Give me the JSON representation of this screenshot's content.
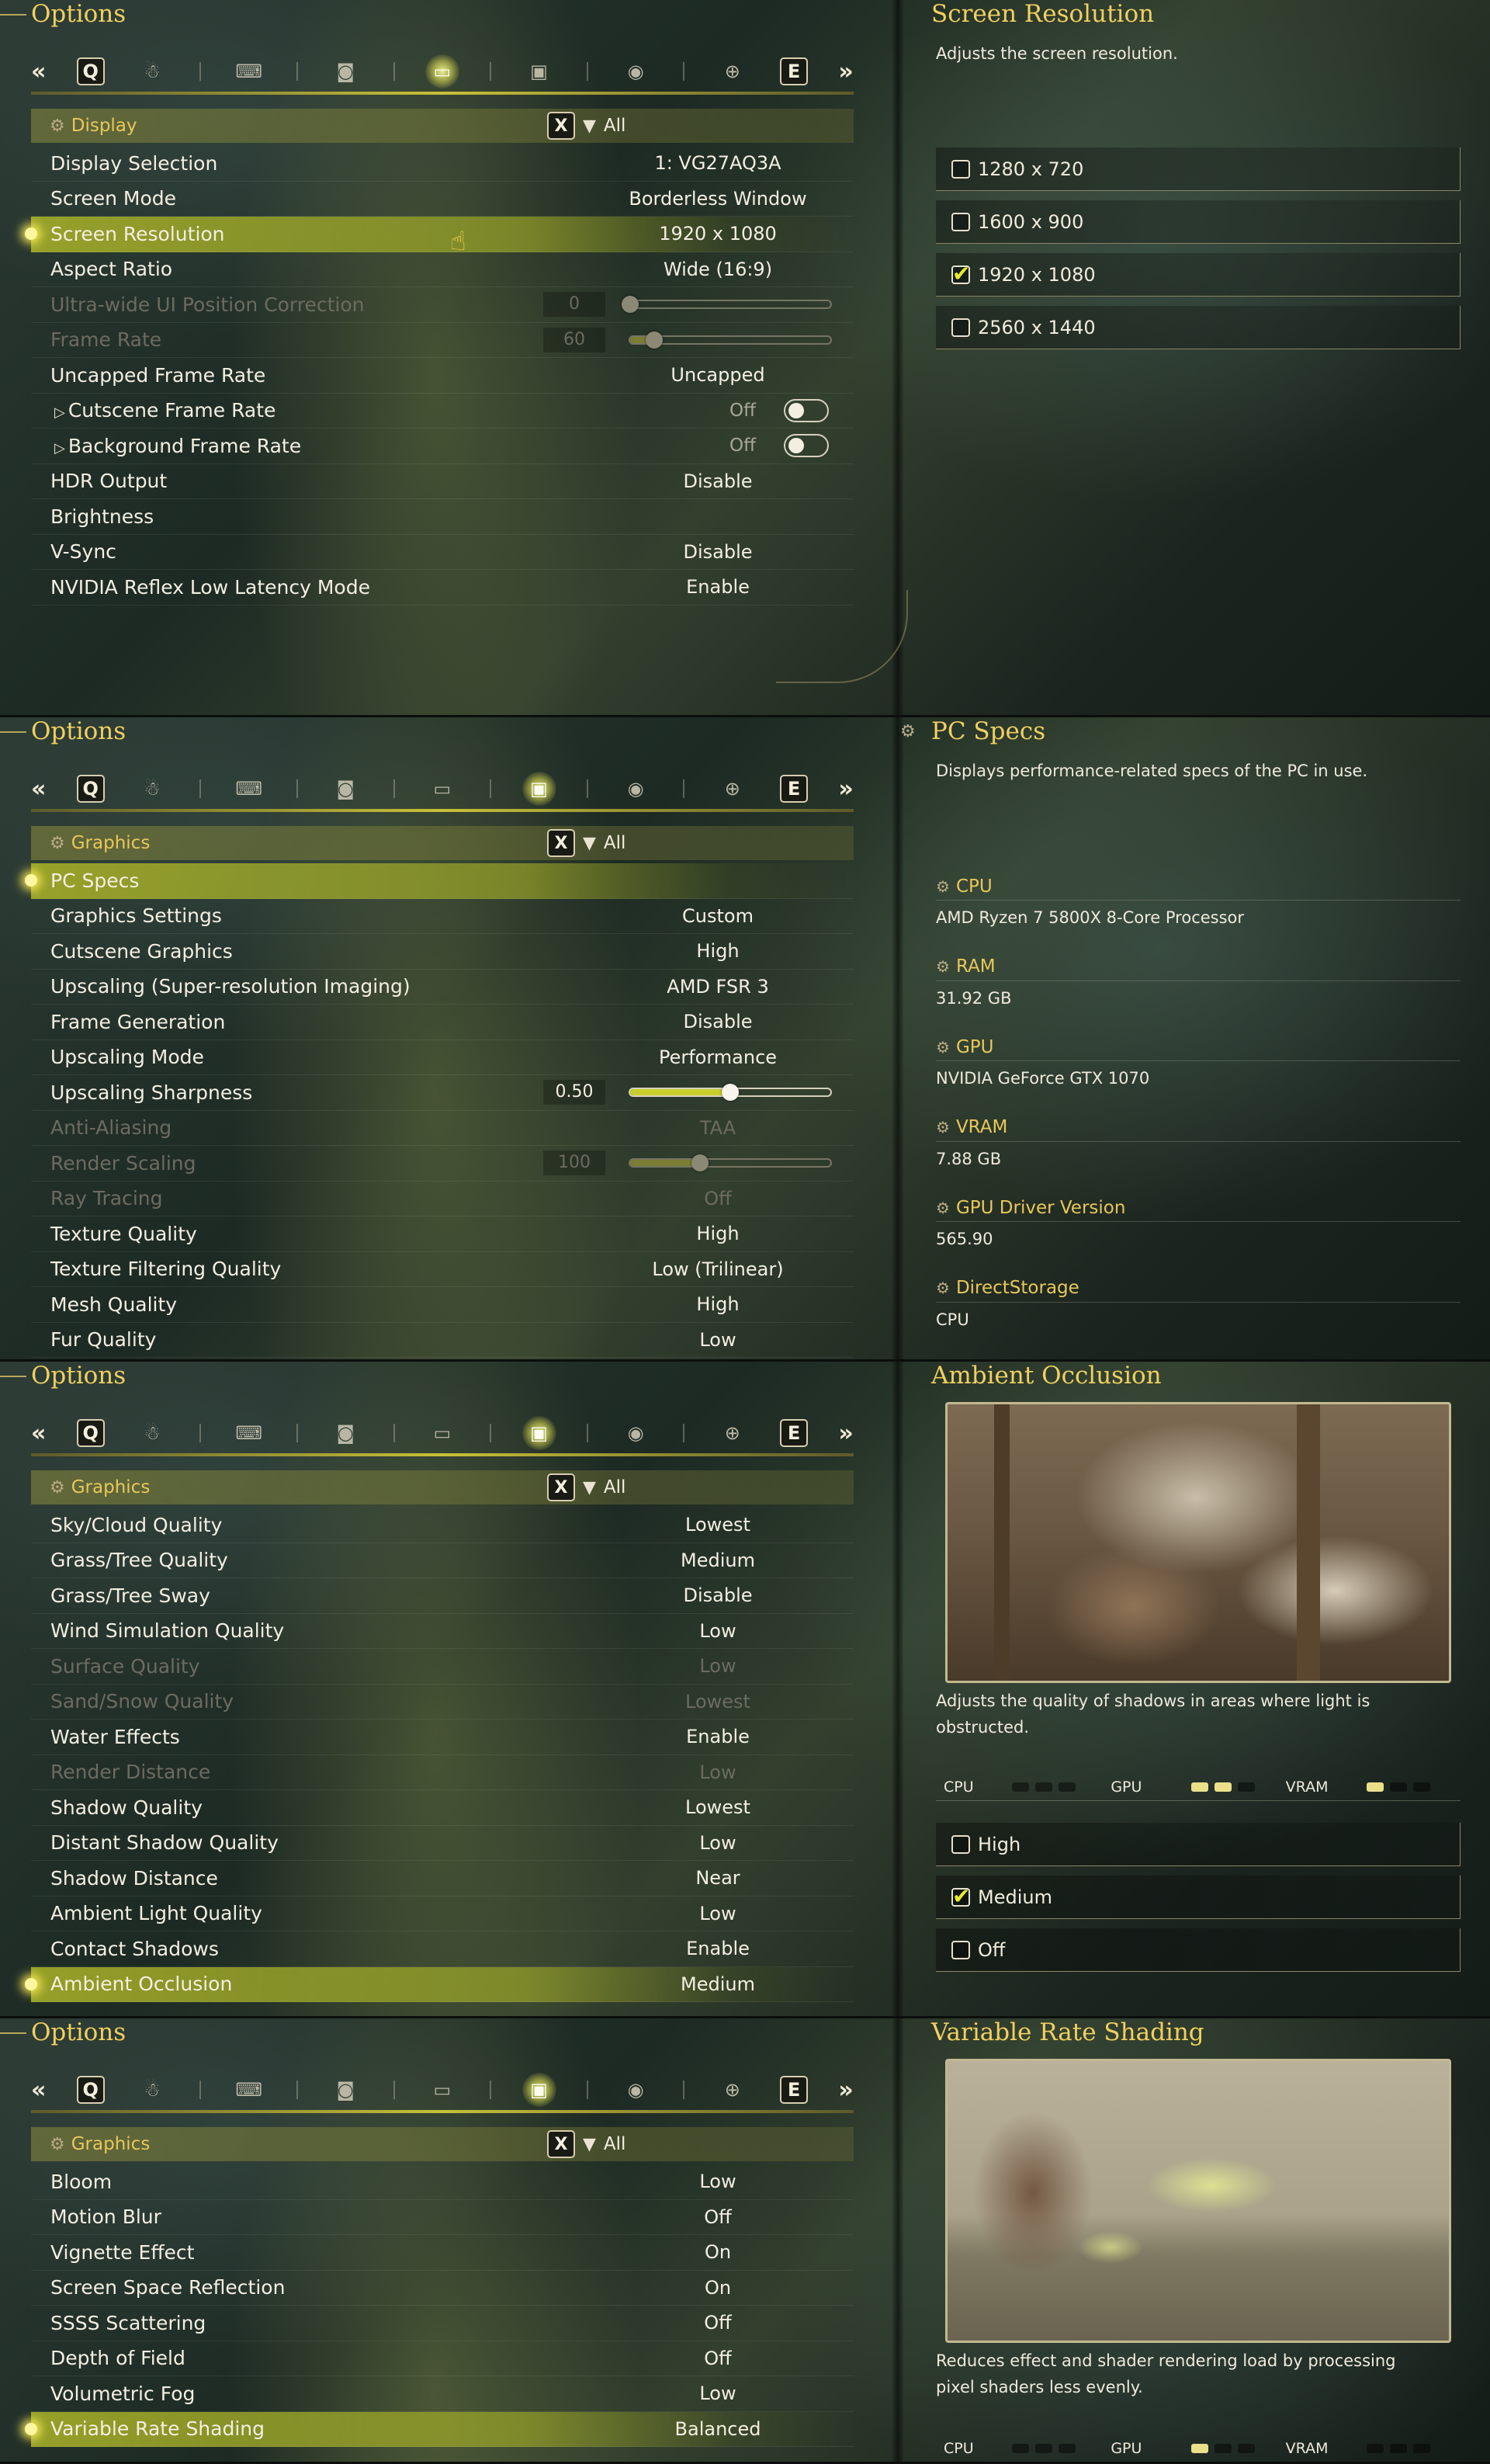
{
  "shared": {
    "options_title": "Options",
    "tab_left_key": "Q",
    "tab_right_key": "E",
    "left_arrows": "«",
    "right_arrows": "»",
    "filter_key": "X",
    "filter_label": "All",
    "tab_icons": [
      "character-icon",
      "controller-icon",
      "camera-icon",
      "display-icon",
      "graphics-icon",
      "audio-icon",
      "accessibility-icon"
    ],
    "accent_color": "#c8cf2a",
    "title_color": "#f0d060"
  },
  "panel1": {
    "category": "Display",
    "rows": [
      {
        "label": "Display Selection",
        "value": "1: VG27AQ3A"
      },
      {
        "label": "Screen Mode",
        "value": "Borderless Window"
      },
      {
        "label": "Screen Resolution",
        "value": "1920 x 1080"
      },
      {
        "label": "Aspect Ratio",
        "value": "Wide (16:9)"
      },
      {
        "label": "Ultra-wide UI Position Correction",
        "value": "0",
        "slider": 0
      },
      {
        "label": "Frame Rate",
        "value": "60",
        "slider": 0.12
      },
      {
        "label": "Uncapped Frame Rate",
        "value": "Uncapped"
      },
      {
        "label": "Cutscene Frame Rate",
        "value": "Off"
      },
      {
        "label": "Background Frame Rate",
        "value": "Off"
      },
      {
        "label": "HDR Output",
        "value": "Disable"
      },
      {
        "label": "Brightness",
        "value": ""
      },
      {
        "label": "V-Sync",
        "value": "Disable"
      },
      {
        "label": "NVIDIA Reflex Low Latency Mode",
        "value": "Enable"
      }
    ],
    "right_title": "Screen Resolution",
    "right_desc": "Adjusts the screen resolution.",
    "choices": [
      {
        "label": "1280 x 720",
        "checked": false
      },
      {
        "label": "1600 x 900",
        "checked": false
      },
      {
        "label": "1920 x 1080",
        "checked": true
      },
      {
        "label": "2560 x 1440",
        "checked": false
      }
    ]
  },
  "panel2": {
    "category": "Graphics",
    "rows": [
      {
        "label": "PC Specs",
        "value": ""
      },
      {
        "label": "Graphics Settings",
        "value": "Custom"
      },
      {
        "label": "Cutscene Graphics",
        "value": "High"
      },
      {
        "label": "Upscaling (Super-resolution Imaging)",
        "value": "AMD FSR 3"
      },
      {
        "label": "Frame Generation",
        "value": "Disable"
      },
      {
        "label": "Upscaling Mode",
        "value": "Performance"
      },
      {
        "label": "Upscaling Sharpness",
        "value": "0.50",
        "slider": 0.5
      },
      {
        "label": "Anti-Aliasing",
        "value": "TAA"
      },
      {
        "label": "Render Scaling",
        "value": "100",
        "slider": 0.35
      },
      {
        "label": "Ray Tracing",
        "value": "Off"
      },
      {
        "label": "Texture Quality",
        "value": "High"
      },
      {
        "label": "Texture Filtering Quality",
        "value": "Low (Trilinear)"
      },
      {
        "label": "Mesh Quality",
        "value": "High"
      },
      {
        "label": "Fur Quality",
        "value": "Low"
      }
    ],
    "right_title": "PC Specs",
    "right_desc": "Displays performance-related specs of the PC in use.",
    "specs": [
      {
        "name": "CPU",
        "value": "AMD Ryzen 7 5800X 8-Core Processor"
      },
      {
        "name": "RAM",
        "value": "31.92 GB"
      },
      {
        "name": "GPU",
        "value": "NVIDIA GeForce GTX 1070"
      },
      {
        "name": "VRAM",
        "value": "7.88 GB"
      },
      {
        "name": "GPU Driver Version",
        "value": "565.90"
      },
      {
        "name": "DirectStorage",
        "value": "CPU"
      }
    ]
  },
  "panel3": {
    "category": "Graphics",
    "rows": [
      {
        "label": "Sky/Cloud Quality",
        "value": "Lowest"
      },
      {
        "label": "Grass/Tree Quality",
        "value": "Medium"
      },
      {
        "label": "Grass/Tree Sway",
        "value": "Disable"
      },
      {
        "label": "Wind Simulation Quality",
        "value": "Low"
      },
      {
        "label": "Surface Quality",
        "value": "Low"
      },
      {
        "label": "Sand/Snow Quality",
        "value": "Lowest"
      },
      {
        "label": "Water Effects",
        "value": "Enable"
      },
      {
        "label": "Render Distance",
        "value": "Low"
      },
      {
        "label": "Shadow Quality",
        "value": "Lowest"
      },
      {
        "label": "Distant Shadow Quality",
        "value": "Low"
      },
      {
        "label": "Shadow Distance",
        "value": "Near"
      },
      {
        "label": "Ambient Light Quality",
        "value": "Low"
      },
      {
        "label": "Contact Shadows",
        "value": "Enable"
      },
      {
        "label": "Ambient Occlusion",
        "value": "Medium"
      }
    ],
    "right_title": "Ambient Occlusion",
    "right_desc": "Adjusts the quality of shadows in areas where light is obstructed.",
    "load": {
      "cpu_label": "CPU",
      "gpu_label": "GPU",
      "vram_label": "VRAM",
      "cpu_level": 0,
      "gpu_level": 2,
      "vram_level": 1
    },
    "choices": [
      {
        "label": "High",
        "checked": false
      },
      {
        "label": "Medium",
        "checked": true
      },
      {
        "label": "Off",
        "checked": false
      }
    ]
  },
  "panel4": {
    "category": "Graphics",
    "rows": [
      {
        "label": "Bloom",
        "value": "Low"
      },
      {
        "label": "Motion Blur",
        "value": "Off"
      },
      {
        "label": "Vignette Effect",
        "value": "On"
      },
      {
        "label": "Screen Space Reflection",
        "value": "On"
      },
      {
        "label": "SSSS Scattering",
        "value": "Off"
      },
      {
        "label": "Depth of Field",
        "value": "Off"
      },
      {
        "label": "Volumetric Fog",
        "value": "Low"
      },
      {
        "label": "Variable Rate Shading",
        "value": "Balanced"
      }
    ],
    "right_title": "Variable Rate Shading",
    "right_desc": "Reduces effect and shader rendering load by processing pixel shaders less evenly.",
    "load": {
      "cpu_label": "CPU",
      "gpu_label": "GPU",
      "vram_label": "VRAM",
      "cpu_level": 0,
      "gpu_level": 1,
      "vram_level": 0
    }
  }
}
